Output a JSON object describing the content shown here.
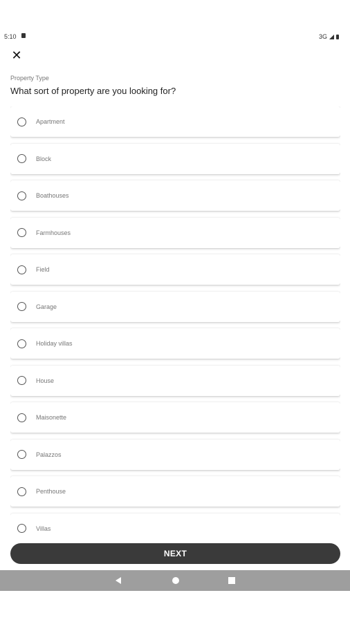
{
  "status_bar": {
    "time": "5:10",
    "network": "3G"
  },
  "header": {
    "close_icon_glyph": "✕",
    "caption": "Property Type",
    "question": "What sort of property are you looking for?"
  },
  "options": [
    {
      "label": "Apartment"
    },
    {
      "label": "Block"
    },
    {
      "label": "Boathouses"
    },
    {
      "label": "Farmhouses"
    },
    {
      "label": "Field"
    },
    {
      "label": "Garage"
    },
    {
      "label": "Holiday villas"
    },
    {
      "label": "House"
    },
    {
      "label": "Maisonette"
    },
    {
      "label": "Palazzos"
    },
    {
      "label": "Penthouse"
    },
    {
      "label": "Villas"
    }
  ],
  "actions": {
    "next_label": "NEXT"
  },
  "colors": {
    "button_bg": "#3a3a3a",
    "nav_bar_bg": "#9e9e9e"
  }
}
